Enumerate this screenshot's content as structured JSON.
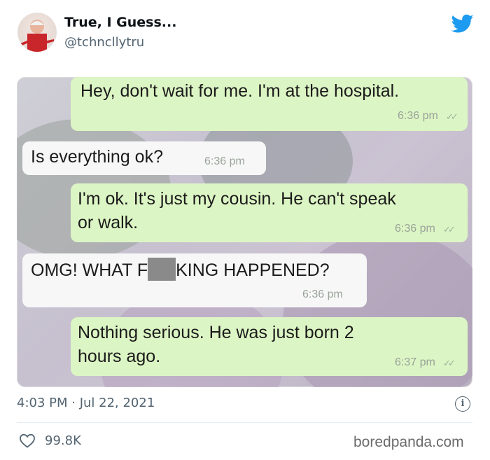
{
  "tweet": {
    "author_name": "True, I Guess...",
    "author_handle": "@tchncllytru",
    "timestamp": "4:03 PM · Jul 22, 2021",
    "likes": "99.8K",
    "brand_icon": "twitter-bird-icon",
    "brand_color": "#1d9bf0"
  },
  "chat": {
    "messages": [
      {
        "direction": "outgoing",
        "text": "Hey, don't wait for me. I'm at the hospital.",
        "time": "6:36 pm",
        "ticks": "read"
      },
      {
        "direction": "incoming",
        "text": "Is everything ok?",
        "time": "6:36 pm"
      },
      {
        "direction": "outgoing",
        "line1": "I'm ok. It's just my cousin. He can't speak",
        "line2": "or walk.",
        "time": "6:36 pm",
        "ticks": "read"
      },
      {
        "direction": "incoming",
        "text_before": "OMG! WHAT F",
        "text_after": "KING HAPPENED?",
        "time": "6:36 pm"
      },
      {
        "direction": "outgoing",
        "line1": "Nothing serious. He was just born 2",
        "line2": "hours ago.",
        "time": "6:37 pm",
        "ticks": "read"
      }
    ],
    "outgoing_color": "#dcf5c4",
    "incoming_color": "#f7f7f7"
  },
  "footer": {
    "watermark": "boredpanda.com"
  }
}
